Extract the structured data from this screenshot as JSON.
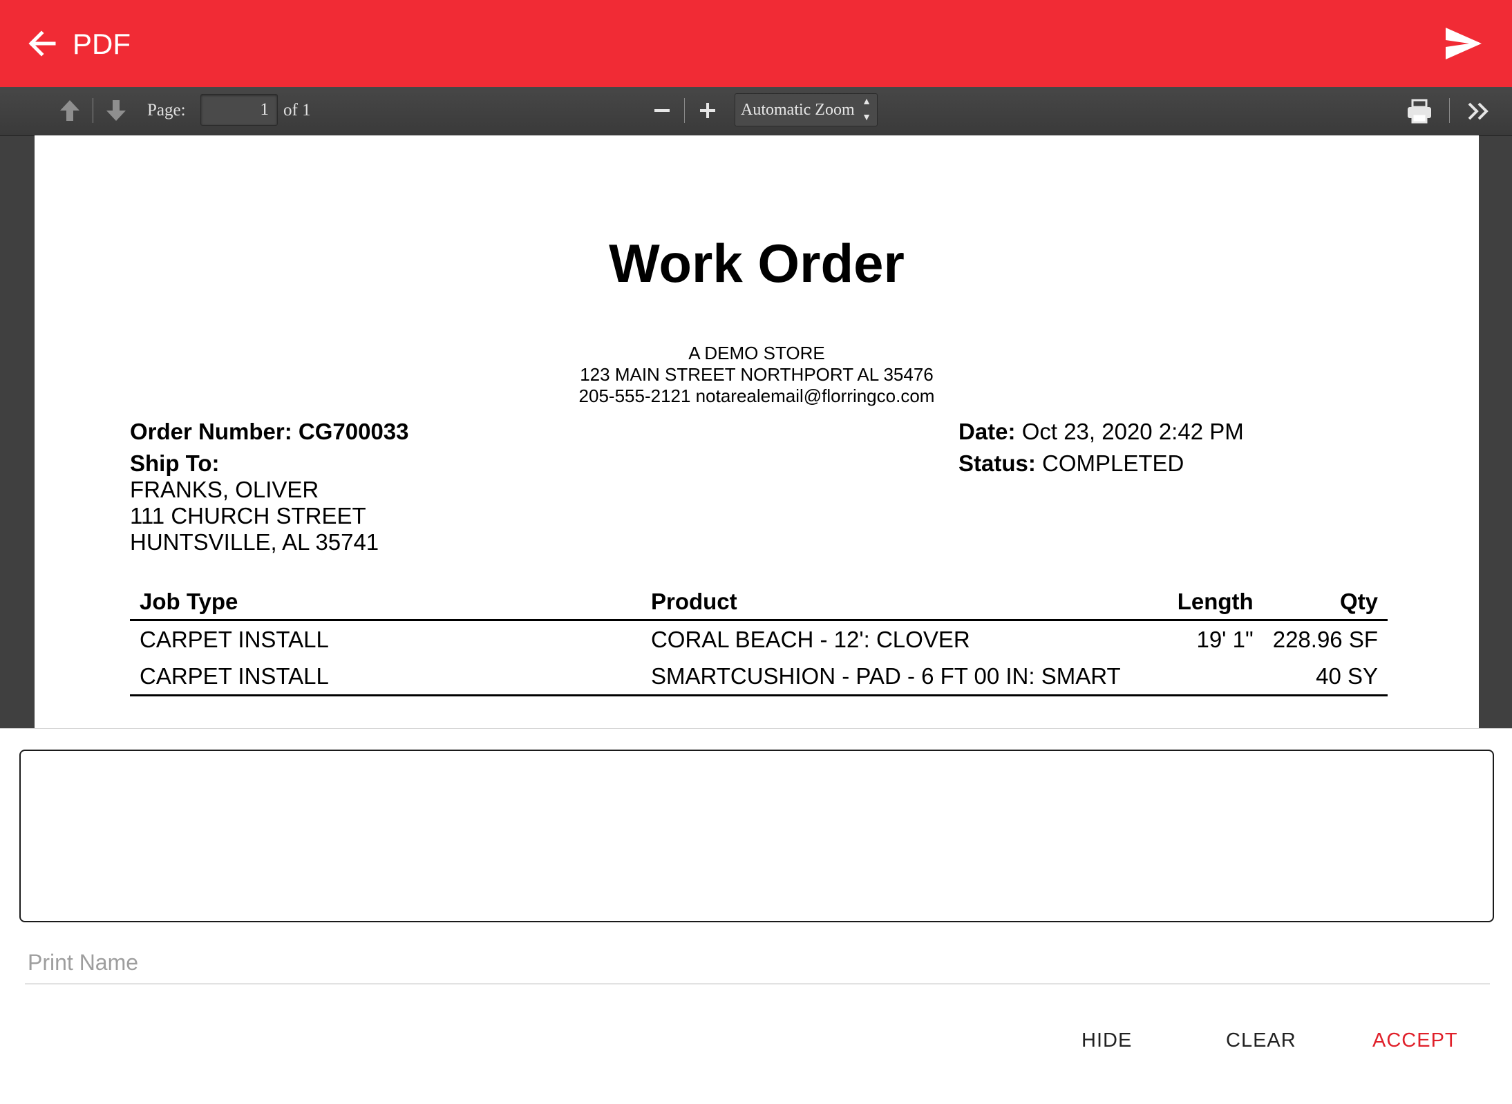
{
  "app_bar": {
    "title": "PDF",
    "back_icon": "arrow-left-icon",
    "send_icon": "send-icon",
    "background_color": "#f12b35"
  },
  "pdf_toolbar": {
    "page_label": "Page:",
    "page_value": "1",
    "page_of": "of 1",
    "zoom_value": "Automatic Zoom",
    "icons": [
      "previous-page-icon",
      "next-page-icon",
      "zoom-out-icon",
      "zoom-in-icon",
      "print-icon",
      "tools-icon"
    ]
  },
  "document": {
    "title": "Work Order",
    "store_name": "A DEMO STORE",
    "store_address": "123 MAIN STREET NORTHPORT AL 35476",
    "store_contact": "205-555-2121 notarealemail@florringco.com",
    "order_number_label": "Order Number:",
    "order_number": "CG700033",
    "date_label": "Date:",
    "date_value": "Oct 23, 2020 2:42 PM",
    "status_label": "Status:",
    "status_value": "COMPLETED",
    "ship_to_label": "Ship To:",
    "ship_to_lines": [
      "FRANKS, OLIVER",
      "111 CHURCH STREET",
      "HUNTSVILLE, AL 35741"
    ],
    "table": {
      "headers": [
        "Job Type",
        "Product",
        "Length",
        "Qty"
      ],
      "rows": [
        [
          "CARPET INSTALL",
          "CORAL BEACH - 12': CLOVER",
          "19' 1\"",
          "228.96 SF"
        ],
        [
          "CARPET INSTALL",
          "SMARTCUSHION - PAD - 6 FT 00 IN: SMART",
          "",
          "40 SY"
        ]
      ]
    }
  },
  "signature": {
    "print_name_placeholder": "Print Name",
    "print_name_value": "",
    "hide_label": "HIDE",
    "clear_label": "CLEAR",
    "accept_label": "ACCEPT",
    "accept_color": "#e0202a",
    "button_color": "#212121"
  }
}
